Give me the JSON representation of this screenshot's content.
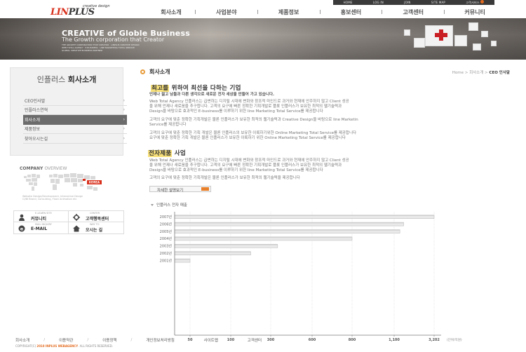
{
  "utility_nav": [
    "HOME",
    "LOG IN",
    "JOIN",
    "SITE MAP",
    "고객서비스"
  ],
  "logo": {
    "sub": "creative design",
    "main_left": "LIN",
    "main_right": "PLUS"
  },
  "gnb": [
    "회사소개",
    "사업분야",
    "제품정보",
    "홍보센터",
    "고객센터",
    "커뮤니티"
  ],
  "visual": {
    "title": "CREATIVE of Globle Business",
    "subtitle": "The Growth corporation that Creator",
    "fine_print": [
      "THE GROWTH CORPORATION THAT CREATOR · LINPLUS CREATIVE DESIGN",
      "WEB TOTAL AGENCY · E-BUSINESS · LINE MARKETING TOTAL SERVICE",
      "GLOBAL CREATIVE BUSINESS PARTNER"
    ]
  },
  "sidebar": {
    "title_light": "인플러스",
    "title_bold": "회사소개",
    "items": [
      {
        "label": "CEO인사말",
        "active": false
      },
      {
        "label": "인플러스연혁",
        "active": false
      },
      {
        "label": "회사소개",
        "active": true
      },
      {
        "label": "제품정보",
        "active": false
      },
      {
        "label": "찾아오시는길",
        "active": false
      }
    ],
    "arrow": "›"
  },
  "overview": {
    "title_bold": "COMPANY",
    "title_light": "OVERVIEW",
    "badge": "KOREA",
    "caption": [
      "Website Design/Development, Interactive Design",
      "CI/BI Brand, Consulting, Flash Animation etc"
    ]
  },
  "quick_menu": [
    {
      "en": "E-LEARN SITE",
      "ko": "커뮤니티",
      "icon": "user-icon"
    },
    {
      "en": "CENTER",
      "ko": "고객행복센터",
      "icon": "gear-icon"
    },
    {
      "en": "MAIL INQUIRY",
      "ko": "E-MAIL",
      "icon": "mail-icon"
    },
    {
      "en": "WAY TO",
      "ko": "오시는 길",
      "icon": "home-icon"
    }
  ],
  "page": {
    "title": "회사소개",
    "breadcrumb_prefix": "Home > 회사소개 > ",
    "breadcrumb_current": "CEO 인사말"
  },
  "section1": {
    "title_hl": "최고를",
    "title_rest": " 위하여 최선을 다하는 기업",
    "lead": "언제나 젊고 남들과 다른 생각으로 새로운 전자 세상을 만들어 가고 있습니다.",
    "para1": [
      "Web Total Agency 인플러스는 급변하는 디지털 시대에 변화와 창조적 마인드로 과거와 현재에 안주하지 않고 Client 성공",
      "을 위해 언제나 새로움을 추구합니다. 고객의 요구에 빠른 정확한 기획개발로 플롯 인플러스가 보유한 최적의 웹기술력과",
      "Design을 바탕으로 효과적인 E-business를 이루하기 위한 line Marketing Total Service를 제공합니다"
    ],
    "para2": [
      "고객의 요구에 맞춘 정확한 기획개발은 물론 인플러스가 보유한 최적의 웹기술력과 Creative Design을 바탕으로 line Marketin",
      "Service를 제공합니다"
    ],
    "para3": [
      "고객의 요구에 맞춘 정확한 기획 개발은 물론 인플러스의 보유한 이룩하기위한 Online Marketing Total Service를 제공합니다",
      "요구에 맞춘 정확한 기획 개발은 물론 인플러스가 보유한 이룩하기 위한 Online Marketing Total Service를 제공합니다"
    ]
  },
  "section2": {
    "title_hl": "전자제품",
    "title_rest": " 사업",
    "para1": [
      "Web Total Agency 인플러스는 급변하는 디지털 시대에 변화와 창조적 마인드로 과거와 현재에 안주하지 않고 Client 성공",
      "을 위해 언제나 새로움을 추구합니다. 고객의 요구에 빠른 정확한 기획개발로 플롯 인플러스가 보유한 최적의 웹기술력과",
      "Design을 바탕으로 효과적인 E-business를 이루하기 위한 line Marketing Total Service를 제공합니다"
    ],
    "para2": [
      "고객의 요구에 맞춘 정확한 기획개발은 물론 인플러스가 보유한 최적의 웹기술력을 제공합니다"
    ],
    "button": "자세한 설명보기"
  },
  "chart_title": "인플러스 전자 매출",
  "chart_data": {
    "type": "bar",
    "orientation": "horizontal",
    "categories": [
      "2007년",
      "2006년",
      "2005년",
      "2004년",
      "2003년",
      "2002년",
      "2001년"
    ],
    "values": [
      3202,
      1600,
      1400,
      800,
      350,
      200,
      50
    ],
    "ticks": [
      50,
      100,
      300,
      600,
      800,
      1100,
      3202
    ],
    "unit_label": "(단위/억원)",
    "grid": true,
    "colors": {
      "bar": "#e9e9e9",
      "bar_top": "#cfcfcf",
      "bar_border": "#b5b5b5",
      "axis": "#7a7a7a",
      "grid": "#dddddd"
    }
  },
  "footer": {
    "links": [
      "회사소개",
      "이용약관",
      "이용정책",
      "개인정보처리방침",
      "사이트맵",
      "고객센터"
    ],
    "copyright_prefix": "COPYRIGHT(C) ",
    "copyright_brand": "2010 INPLUS WEBAGENCY",
    "copyright_suffix": ". ALL RIGHTS RESERVED."
  },
  "colors": {
    "accent": "#e36a1f",
    "brand_red": "#d8301c",
    "highlight": "#f7e07a"
  }
}
